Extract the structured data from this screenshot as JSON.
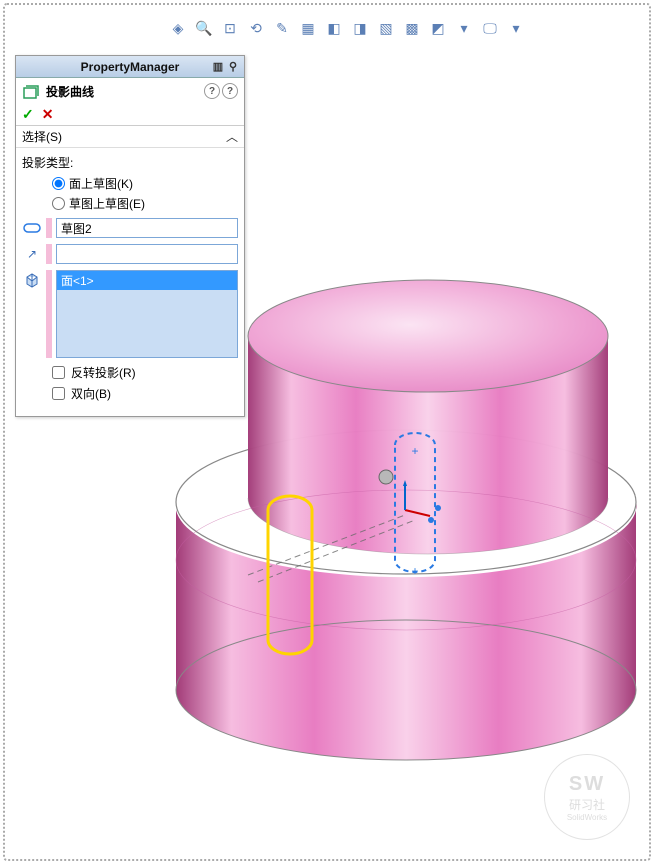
{
  "panel": {
    "title": "PropertyManager",
    "feature_name": "投影曲线",
    "ok_symbol": "✓",
    "cancel_symbol": "✕"
  },
  "section": {
    "head": "选择(S)",
    "collapse_symbol": "︿",
    "subtitle": "投影类型:",
    "radio1": "面上草图(K)",
    "radio2": "草图上草图(E)",
    "sketch_value": "草图2",
    "face_value": "面<1>",
    "check1": "反转投影(R)",
    "check2": "双向(B)"
  },
  "watermark": {
    "line1": "SW",
    "line2": "研习社",
    "line3": "SolidWorks"
  },
  "toolbar_icons": [
    "view-orientation",
    "zoom-fit",
    "zoom-area",
    "zoom-previous",
    "section-view",
    "view-settings",
    "render-mode",
    "hidden-lines",
    "wireframe",
    "shaded",
    "shaded-edges",
    "dropdown-sep",
    "display-style"
  ]
}
